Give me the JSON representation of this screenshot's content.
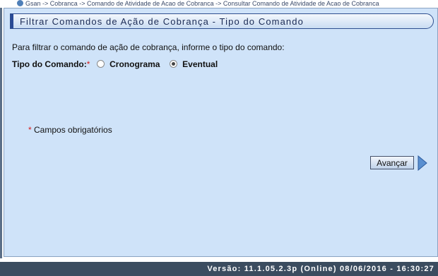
{
  "breadcrumb": {
    "text": "Gsan -> Cobranca -> Comando de Atividade de Acao de Cobranca -> Consultar Comando de Atividade de Acao de Cobranca"
  },
  "header": {
    "title": "Filtrar Comandos de Ação de Cobrança - Tipo do Comando"
  },
  "form": {
    "instruction": "Para filtrar o comando de ação de cobrança, informe o tipo do comando:",
    "tipo_label": "Tipo do Comando:",
    "required_marker": "*",
    "options": [
      {
        "label": "Cronograma",
        "selected": false
      },
      {
        "label": "Eventual",
        "selected": true
      }
    ],
    "required_note_marker": "*",
    "required_note": "Campos obrigatórios",
    "advance_label": "Avançar"
  },
  "footer": {
    "version": "Versão: 11.1.05.2.3p (Online) 08/06/2016 - 16:30:27"
  },
  "colors": {
    "panel_bg": "#cfe3f9",
    "header_border": "#2f4f8f",
    "required": "#d61c1c",
    "footer_bg": "#3b4c5f"
  }
}
